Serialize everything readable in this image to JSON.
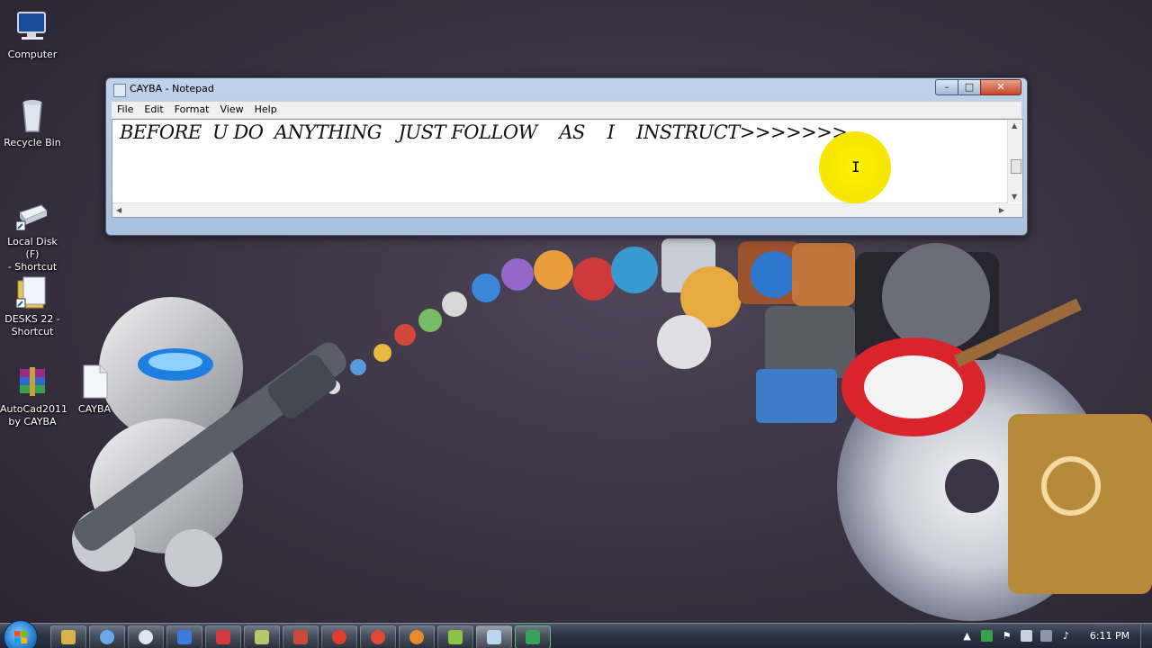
{
  "desktop": {
    "icons": [
      {
        "label": "Computer",
        "icon": "computer-icon"
      },
      {
        "label": "Recycle Bin",
        "icon": "recycle-bin-icon"
      },
      {
        "label": "Local Disk (F)\n- Shortcut",
        "icon": "drive-shortcut-icon"
      },
      {
        "label": "DESKS 22 -\nShortcut",
        "icon": "folder-shortcut-icon"
      },
      {
        "label": "AutoCad2011\nby CAYBA",
        "icon": "winrar-archive-icon"
      },
      {
        "label": "CAYBA",
        "icon": "text-file-icon"
      }
    ]
  },
  "notepad": {
    "title": "CAYBA - Notepad",
    "menu": [
      "File",
      "Edit",
      "Format",
      "View",
      "Help"
    ],
    "content": "BEFORE  U DO  ANYTHING   JUST FOLLOW    AS    I    INSTRUCT>>>>>>>.",
    "controls": {
      "minimize": "–",
      "maximize": "□",
      "close": "✕"
    }
  },
  "taskbar": {
    "buttons": [
      {
        "icon": "windows-explorer-icon",
        "color": "#d9b24a"
      },
      {
        "icon": "itunes-icon",
        "color": "#6aa8e8"
      },
      {
        "icon": "media-icon",
        "color": "#dfe6ee"
      },
      {
        "icon": "app-arrow-icon",
        "color": "#3a7be0"
      },
      {
        "icon": "flag-app-icon",
        "color": "#d23b3b"
      },
      {
        "icon": "autocad-icon",
        "color": "#b6c86a"
      },
      {
        "icon": "photo-app-icon",
        "color": "#c94a3a"
      },
      {
        "icon": "opera-icon",
        "color": "#e23c2c"
      },
      {
        "icon": "chrome-icon",
        "color": "#e04a3a"
      },
      {
        "icon": "firefox-icon",
        "color": "#e8892a"
      },
      {
        "icon": "folder-window-icon",
        "color": "#8bc34a"
      },
      {
        "icon": "notepad-icon",
        "color": "#b9d7ef"
      },
      {
        "icon": "camtasia-icon",
        "color": "#3aa05a"
      }
    ],
    "tray": {
      "time": "6:11 PM"
    }
  }
}
